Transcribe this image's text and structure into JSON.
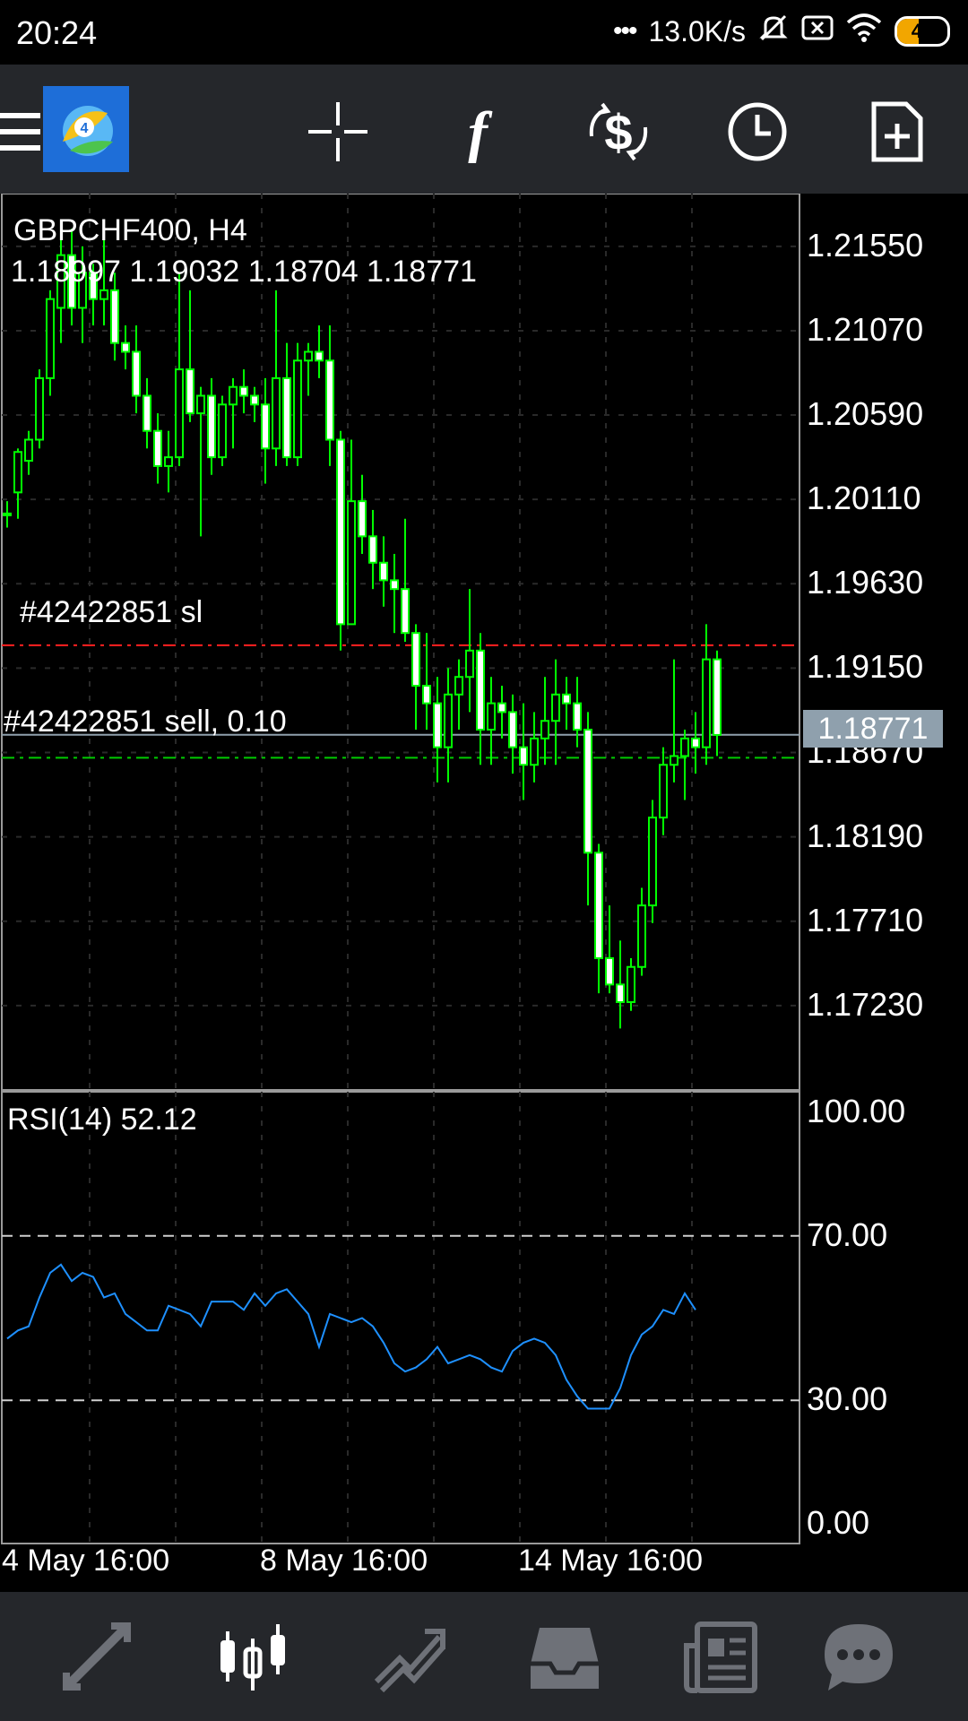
{
  "status_bar": {
    "time": "20:24",
    "network_speed": "13.0K/s",
    "battery": "43",
    "battery_level": 0.43,
    "icons": [
      "dots-icon",
      "mute-icon",
      "sim-x-icon",
      "wifi-icon",
      "battery-icon"
    ]
  },
  "toolbar": {
    "icons": [
      "menu-icon",
      "metatrader-logo",
      "crosshair-icon",
      "indicator-icon",
      "symbols-icon",
      "timeframe-icon",
      "new-order-icon"
    ],
    "logo_text": "4"
  },
  "chart": {
    "symbol_line": "GBPCHF400, H4",
    "ohlc_line": "1.18997 1.19032 1.18704 1.18771",
    "sl_label": "#42422851 sl",
    "order_label": "#42422851 sell, 0.10",
    "current_price": "1.18771",
    "price_labels": [
      "1.21550",
      "1.21070",
      "1.20590",
      "1.20110",
      "1.19630",
      "1.19150",
      "1.18670",
      "1.18190",
      "1.17710",
      "1.17230"
    ],
    "rsi_label": "RSI(14) 52.12",
    "rsi_levels": [
      "100.00",
      "70.00",
      "30.00",
      "0.00"
    ],
    "date_labels": [
      "4 May 16:00",
      "8 May 16:00",
      "14 May 16:00"
    ],
    "colors": {
      "bull_candle": "#00ff00",
      "sl_line": "#ff2020",
      "order_line": "#00cc00",
      "rsi_line": "#1e90ff",
      "price_box": "#8fa0ad"
    }
  },
  "chart_data": {
    "type": "candlestick",
    "ylim": [
      1.1675,
      1.2185
    ],
    "sl_price": 1.1928,
    "entry_price": 1.1864,
    "bid_price": 1.18771,
    "candles": [
      [
        1.2003,
        1.201,
        1.1995,
        1.2002
      ],
      [
        1.2015,
        1.204,
        1.2,
        1.2038
      ],
      [
        1.2033,
        1.205,
        1.2025,
        1.2045
      ],
      [
        1.2045,
        1.2085,
        1.204,
        1.208
      ],
      [
        1.208,
        1.213,
        1.207,
        1.2125
      ],
      [
        1.212,
        1.216,
        1.21,
        1.215
      ],
      [
        1.215,
        1.2165,
        1.211,
        1.212
      ],
      [
        1.212,
        1.2155,
        1.21,
        1.214
      ],
      [
        1.214,
        1.2145,
        1.211,
        1.2125
      ],
      [
        1.2125,
        1.217,
        1.211,
        1.213
      ],
      [
        1.213,
        1.214,
        1.209,
        1.21
      ],
      [
        1.21,
        1.211,
        1.2085,
        1.2095
      ],
      [
        1.2095,
        1.211,
        1.206,
        1.207
      ],
      [
        1.207,
        1.208,
        1.204,
        1.205
      ],
      [
        1.205,
        1.206,
        1.202,
        1.203
      ],
      [
        1.203,
        1.205,
        1.2015,
        1.2035
      ],
      [
        1.2035,
        1.214,
        1.203,
        1.2085
      ],
      [
        1.2085,
        1.213,
        1.2055,
        1.206
      ],
      [
        1.206,
        1.2075,
        1.199,
        1.207
      ],
      [
        1.207,
        1.208,
        1.2025,
        1.2035
      ],
      [
        1.2035,
        1.207,
        1.203,
        1.2065
      ],
      [
        1.2065,
        1.208,
        1.204,
        1.2075
      ],
      [
        1.2075,
        1.2085,
        1.206,
        1.207
      ],
      [
        1.207,
        1.2075,
        1.2055,
        1.2065
      ],
      [
        1.2065,
        1.208,
        1.202,
        1.204
      ],
      [
        1.204,
        1.213,
        1.203,
        1.208
      ],
      [
        1.208,
        1.21,
        1.203,
        1.2035
      ],
      [
        1.2035,
        1.21,
        1.203,
        1.209
      ],
      [
        1.209,
        1.21,
        1.207,
        1.2095
      ],
      [
        1.2095,
        1.211,
        1.208,
        1.209
      ],
      [
        1.209,
        1.211,
        1.203,
        1.2045
      ],
      [
        1.2045,
        1.205,
        1.1925,
        1.194
      ],
      [
        1.194,
        1.2045,
        1.194,
        1.201
      ],
      [
        1.201,
        1.2025,
        1.198,
        1.199
      ],
      [
        1.199,
        1.2005,
        1.196,
        1.1975
      ],
      [
        1.1975,
        1.199,
        1.195,
        1.1965
      ],
      [
        1.1965,
        1.198,
        1.1935,
        1.196
      ],
      [
        1.196,
        1.2,
        1.193,
        1.1935
      ],
      [
        1.1935,
        1.194,
        1.188,
        1.1905
      ],
      [
        1.1905,
        1.1935,
        1.188,
        1.1895
      ],
      [
        1.1895,
        1.191,
        1.185,
        1.187
      ],
      [
        1.187,
        1.1915,
        1.185,
        1.19
      ],
      [
        1.19,
        1.192,
        1.188,
        1.191
      ],
      [
        1.191,
        1.196,
        1.189,
        1.1925
      ],
      [
        1.1925,
        1.1935,
        1.186,
        1.188
      ],
      [
        1.188,
        1.191,
        1.186,
        1.1895
      ],
      [
        1.1895,
        1.1905,
        1.1875,
        1.189
      ],
      [
        1.189,
        1.19,
        1.1855,
        1.187
      ],
      [
        1.187,
        1.1895,
        1.184,
        1.186
      ],
      [
        1.186,
        1.189,
        1.185,
        1.1875
      ],
      [
        1.1875,
        1.191,
        1.186,
        1.1885
      ],
      [
        1.1885,
        1.192,
        1.186,
        1.19
      ],
      [
        1.19,
        1.191,
        1.188,
        1.1895
      ],
      [
        1.1895,
        1.191,
        1.187,
        1.188
      ],
      [
        1.188,
        1.189,
        1.178,
        1.181
      ],
      [
        1.181,
        1.1815,
        1.173,
        1.175
      ],
      [
        1.175,
        1.178,
        1.173,
        1.1735
      ],
      [
        1.1735,
        1.176,
        1.171,
        1.1725
      ],
      [
        1.1725,
        1.175,
        1.172,
        1.1745
      ],
      [
        1.1745,
        1.179,
        1.174,
        1.178
      ],
      [
        1.178,
        1.184,
        1.177,
        1.183
      ],
      [
        1.183,
        1.187,
        1.182,
        1.186
      ],
      [
        1.186,
        1.192,
        1.185,
        1.1865
      ],
      [
        1.1865,
        1.188,
        1.184,
        1.1875
      ],
      [
        1.1875,
        1.189,
        1.1855,
        1.187
      ],
      [
        1.187,
        1.194,
        1.186,
        1.192
      ],
      [
        1.192,
        1.1925,
        1.1865,
        1.1877
      ]
    ],
    "rsi_ylim": [
      0,
      100
    ],
    "rsi": [
      45,
      47,
      48,
      55,
      61,
      63,
      59,
      61,
      60,
      55,
      56,
      51,
      49,
      47,
      47,
      53,
      52,
      51,
      48,
      54,
      54,
      54,
      52,
      56,
      53,
      56,
      57,
      54,
      51,
      43,
      51,
      50,
      49,
      50,
      48,
      44,
      39,
      37,
      38,
      40,
      43,
      39,
      40,
      41,
      40,
      38,
      37,
      42,
      44,
      45,
      44,
      41,
      35,
      31,
      28,
      28,
      28,
      33,
      41,
      46,
      48,
      52,
      51,
      56,
      52
    ]
  }
}
